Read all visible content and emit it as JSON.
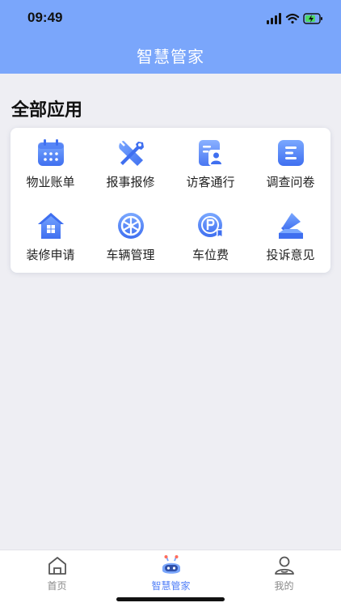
{
  "status_bar": {
    "time": "09:49"
  },
  "nav": {
    "title": "智慧管家"
  },
  "section": {
    "title": "全部应用"
  },
  "apps": [
    {
      "label": "物业账单",
      "icon": "calendar-icon"
    },
    {
      "label": "报事报修",
      "icon": "wrench-screwdriver-icon"
    },
    {
      "label": "访客通行",
      "icon": "visitor-pass-icon"
    },
    {
      "label": "调查问卷",
      "icon": "survey-list-icon"
    },
    {
      "label": "装修申请",
      "icon": "house-icon"
    },
    {
      "label": "车辆管理",
      "icon": "wheel-icon"
    },
    {
      "label": "车位费",
      "icon": "parking-icon"
    },
    {
      "label": "投诉意见",
      "icon": "complaint-icon"
    }
  ],
  "tabbar": {
    "items": [
      {
        "label": "首页",
        "icon": "home-icon",
        "active": false
      },
      {
        "label": "智慧管家",
        "icon": "robot-icon",
        "active": true
      },
      {
        "label": "我的",
        "icon": "user-icon",
        "active": false
      }
    ]
  },
  "colors": {
    "header": "#7aa6fb",
    "accent": "#4f7ef7",
    "background": "#eeeef3"
  }
}
